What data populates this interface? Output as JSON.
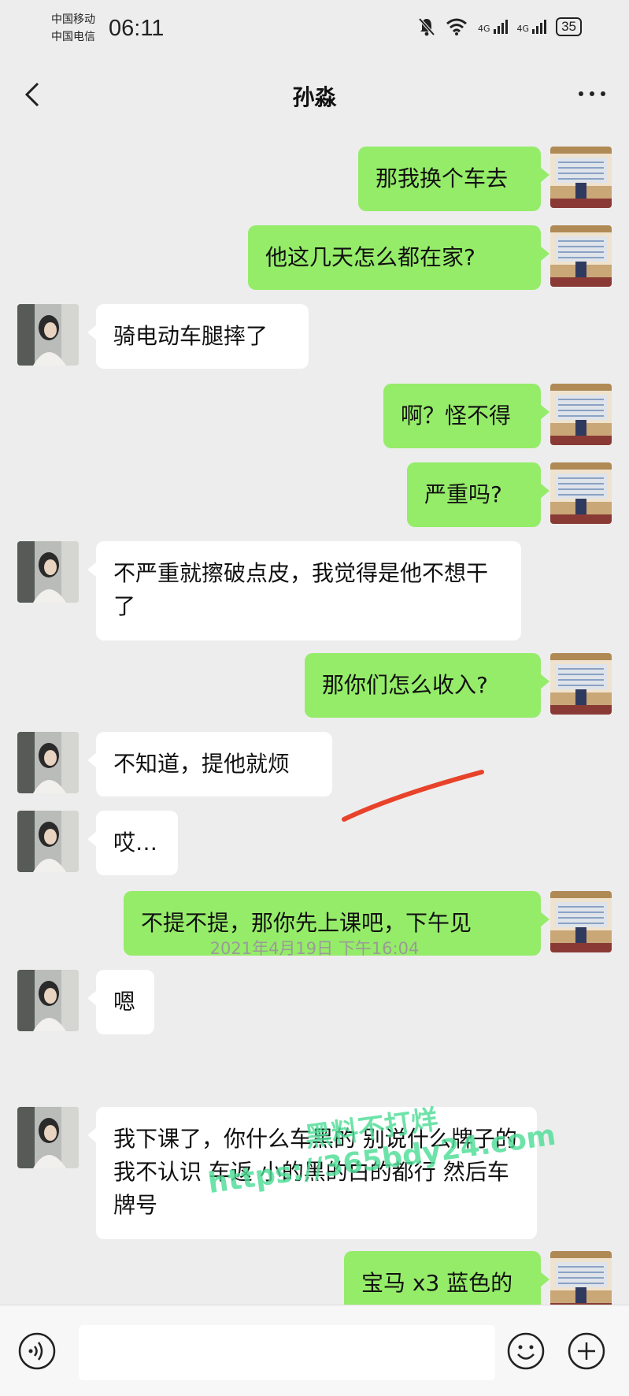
{
  "status_bar": {
    "carrier_1": "中国移动",
    "carrier_2": "中国电信",
    "time": "06:11",
    "network_1": "4G",
    "network_2": "4G",
    "battery": "35"
  },
  "nav": {
    "title": "孙淼",
    "back_icon": "chevron-left-icon",
    "more_icon": "more-dots-icon"
  },
  "messages": [
    {
      "sender": "me",
      "text": "那我换个车去"
    },
    {
      "sender": "me",
      "text": "他这几天怎么都在家?"
    },
    {
      "sender": "other",
      "text": "骑电动车腿摔了"
    },
    {
      "sender": "me",
      "text": "啊？怪不得"
    },
    {
      "sender": "me",
      "text": "严重吗?"
    },
    {
      "sender": "other",
      "text": "不严重就擦破点皮，我觉得是他不想干了"
    },
    {
      "sender": "me",
      "text": "那你们怎么收入?"
    },
    {
      "sender": "other",
      "text": "不知道，提他就烦"
    },
    {
      "sender": "other",
      "text": "哎…"
    },
    {
      "sender": "me",
      "text": "不提不提，那你先上课吧，下午见"
    },
    {
      "sender": "other",
      "text": "嗯"
    },
    {
      "sender": "other",
      "text": "我下课了，你什么车黑的 别说什么牌子的我不认识 车返 小的黑的白的都行 然后车牌号"
    },
    {
      "sender": "me",
      "text": "宝马 x3 蓝色的"
    }
  ],
  "timestamp": "2021年4月19日 下午16:04",
  "input_bar": {
    "voice_icon": "voice-icon",
    "emoji_icon": "emoji-icon",
    "plus_icon": "plus-icon",
    "input_value": ""
  },
  "watermark": {
    "line1": "黑料不打烊",
    "line2": "https://365bdy24.com"
  },
  "colors": {
    "background": "#ededed",
    "my_bubble": "#95ec69",
    "other_bubble": "#ffffff",
    "annotation_stroke": "#e8432a",
    "watermark": "#4edd96"
  }
}
